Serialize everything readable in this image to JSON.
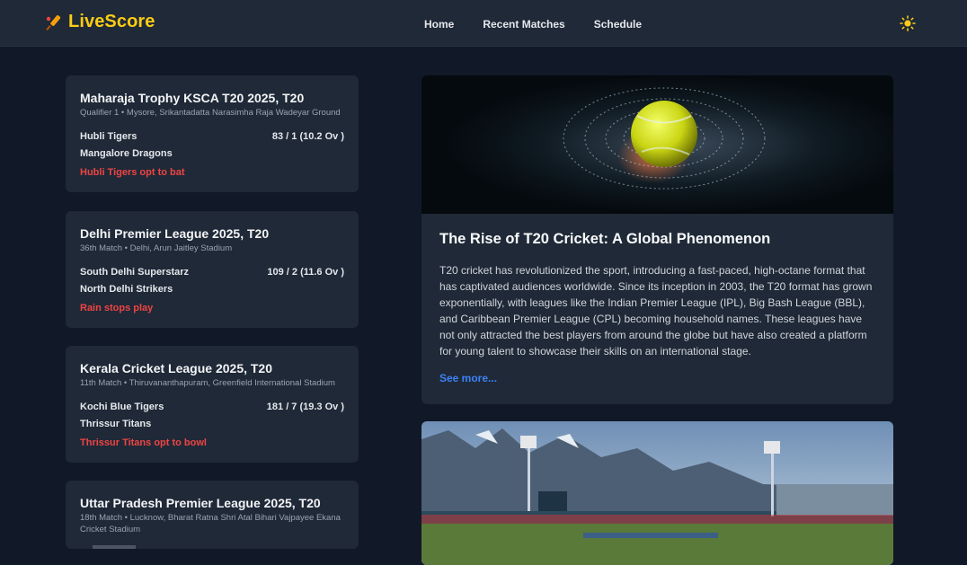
{
  "app": {
    "logo_text": "LiveScore",
    "accent": "#facc15",
    "logo_icon": "cricket-bat-icon"
  },
  "nav": {
    "items": [
      {
        "label": "Home"
      },
      {
        "label": "Recent Matches"
      },
      {
        "label": "Schedule"
      }
    ],
    "theme_icon": "sun-icon"
  },
  "matches": [
    {
      "title": "Maharaja Trophy KSCA T20 2025, T20",
      "subtitle": "Qualifier 1 • Mysore, Srikantadatta Narasimha Raja Wadeyar Ground",
      "team1": "Hubli Tigers",
      "score1": "83 / 1 (10.2 Ov )",
      "team2": "Mangalore Dragons",
      "status": "Hubli Tigers opt to bat"
    },
    {
      "title": "Delhi Premier League 2025, T20",
      "subtitle": "36th Match • Delhi, Arun Jaitley Stadium",
      "team1": "South Delhi Superstarz",
      "score1": "109 / 2 (11.6 Ov )",
      "team2": "North Delhi Strikers",
      "status": "Rain stops play"
    },
    {
      "title": "Kerala Cricket League 2025, T20",
      "subtitle": "11th Match • Thiruvananthapuram, Greenfield International Stadium",
      "team1": "Kochi Blue Tigers",
      "score1": "181 / 7 (19.3 Ov )",
      "team2": "Thrissur Titans",
      "status": "Thrissur Titans opt to bowl"
    },
    {
      "title": "Uttar Pradesh Premier League 2025, T20",
      "subtitle": "18th Match • Lucknow, Bharat Ratna Shri Atal Bihari Vajpayee Ekana Cricket Stadium",
      "team1": "",
      "score1": "",
      "team2": "",
      "status": ""
    }
  ],
  "articles": [
    {
      "title": "The Rise of T20 Cricket: A Global Phenomenon",
      "body": "T20 cricket has revolutionized the sport, introducing a fast-paced, high-octane format that has captivated audiences worldwide. Since its inception in 2003, the T20 format has grown exponentially, with leagues like the Indian Premier League (IPL), Big Bash League (BBL), and Caribbean Premier League (CPL) becoming household names. These leagues have not only attracted the best players from around the globe but have also created a platform for young talent to showcase their skills on an international stage.",
      "link": "See more..."
    }
  ]
}
